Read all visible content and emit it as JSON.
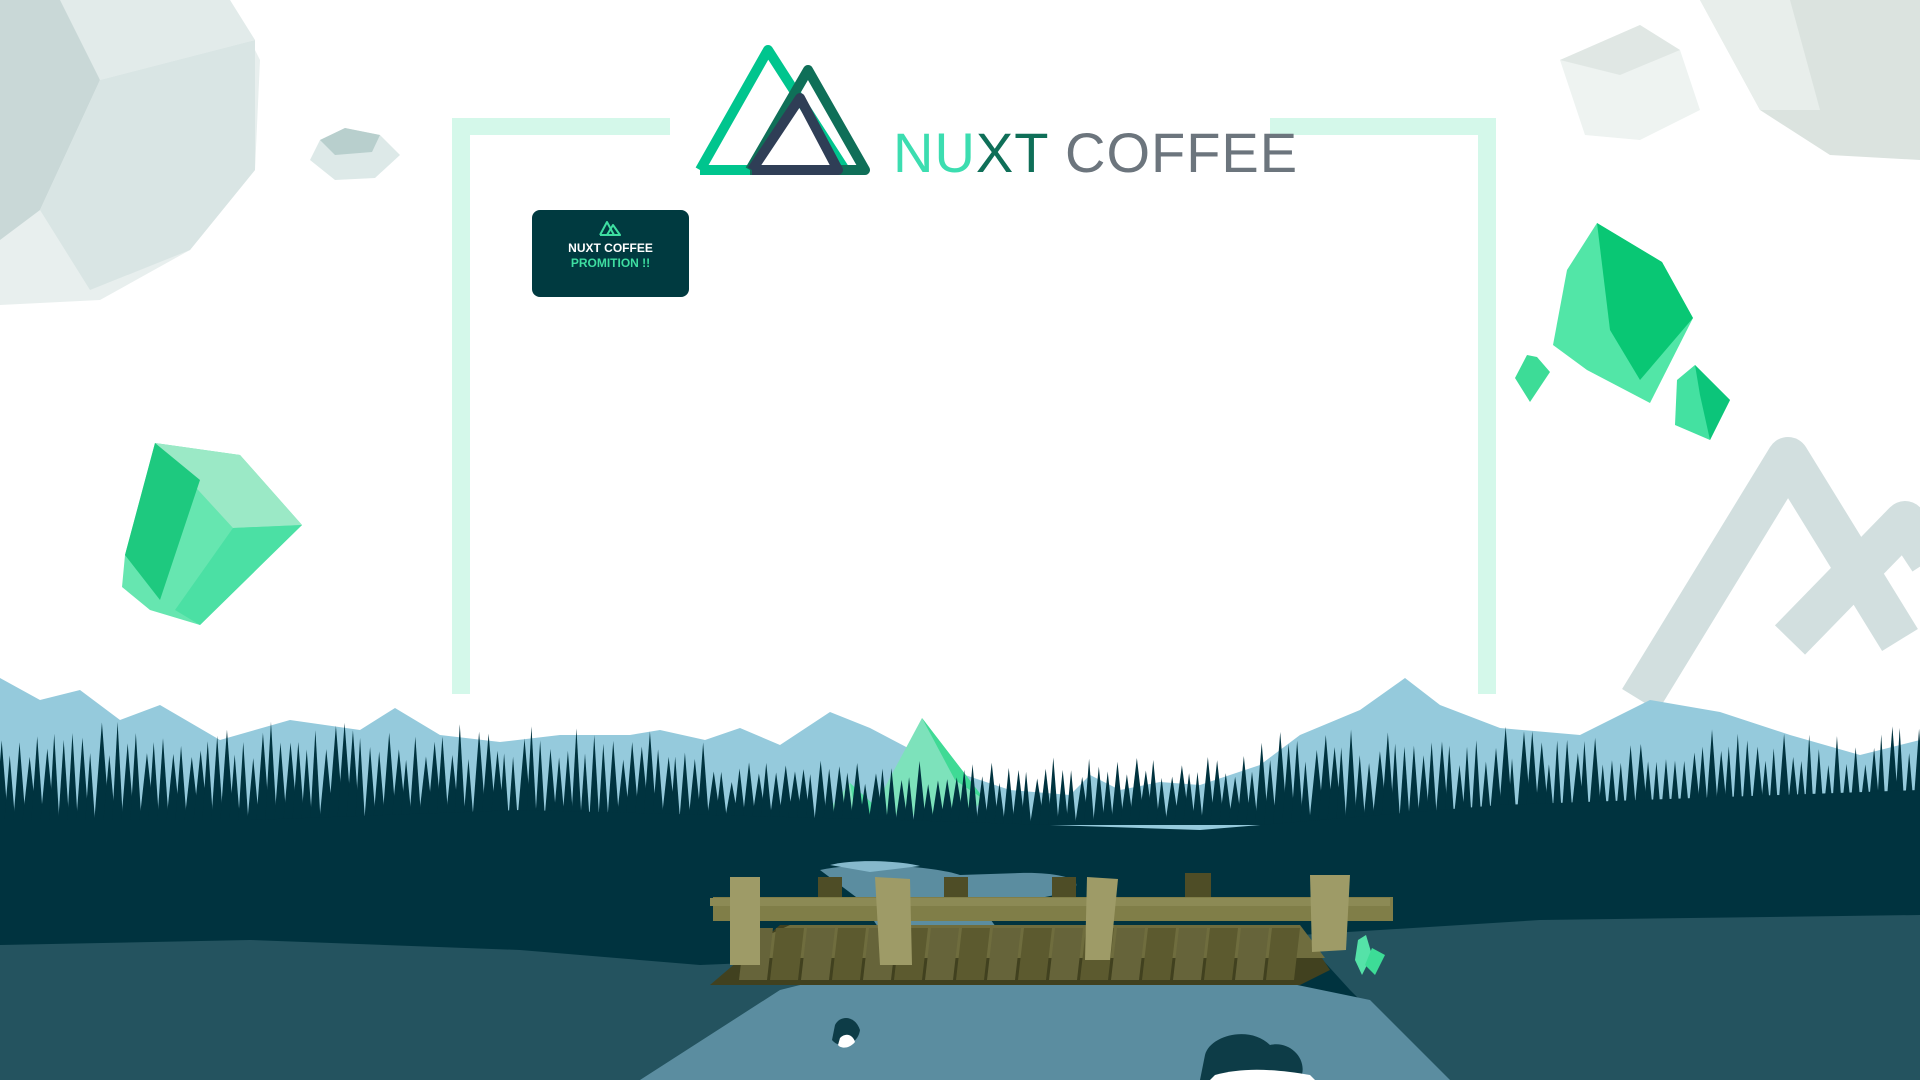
{
  "brand": {
    "title_part1": "NU",
    "title_part2": "XT",
    "title_part3": " COFFEE",
    "colors": {
      "nuxt_light": "#3cddb0",
      "nuxt_dark": "#0f6f58",
      "coffee_gray": "#6c757d",
      "logo_green": "#00c58e",
      "logo_navy": "#2f3e56"
    }
  },
  "promo": {
    "line1": "NUXT COFFEE",
    "line2": "PROMITION !!",
    "icon": "nuxt-logo-icon",
    "colors": {
      "background": "#003a40",
      "accent": "#3edea1"
    }
  },
  "scene": {
    "colors": {
      "frame": "#d4f8ea",
      "mountain": "#95cadc",
      "forest": "#00333f",
      "ground": "#24535f",
      "water": "#5b8da0",
      "crystal": "#3ddc97",
      "rock": "#d7e3e2",
      "bridge_wood": "#8c8a55"
    }
  }
}
